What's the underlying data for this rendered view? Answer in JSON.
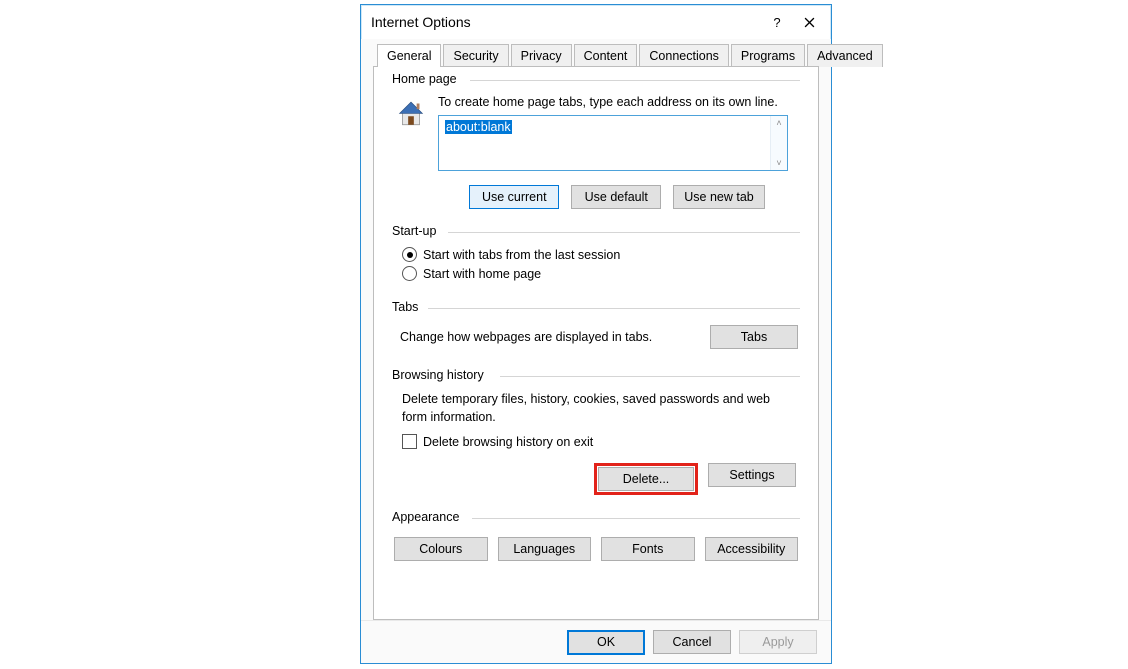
{
  "title": "Internet Options",
  "tabs": [
    "General",
    "Security",
    "Privacy",
    "Content",
    "Connections",
    "Programs",
    "Advanced"
  ],
  "active_tab": "General",
  "home_page": {
    "legend": "Home page",
    "instruction": "To create home page tabs, type each address on its own line.",
    "value": "about:blank",
    "buttons": {
      "use_current": "Use current",
      "use_default": "Use default",
      "use_new_tab": "Use new tab"
    }
  },
  "startup": {
    "legend": "Start-up",
    "opt_last_session": "Start with tabs from the last session",
    "opt_home_page": "Start with home page",
    "selected": "last_session"
  },
  "tabs_section": {
    "legend": "Tabs",
    "text": "Change how webpages are displayed in tabs.",
    "button": "Tabs"
  },
  "browsing_history": {
    "legend": "Browsing history",
    "text": "Delete temporary files, history, cookies, saved passwords and web form information.",
    "checkbox_label": "Delete browsing history on exit",
    "delete_btn": "Delete...",
    "settings_btn": "Settings"
  },
  "appearance": {
    "legend": "Appearance",
    "colours": "Colours",
    "languages": "Languages",
    "fonts": "Fonts",
    "accessibility": "Accessibility"
  },
  "dialog_buttons": {
    "ok": "OK",
    "cancel": "Cancel",
    "apply": "Apply"
  }
}
